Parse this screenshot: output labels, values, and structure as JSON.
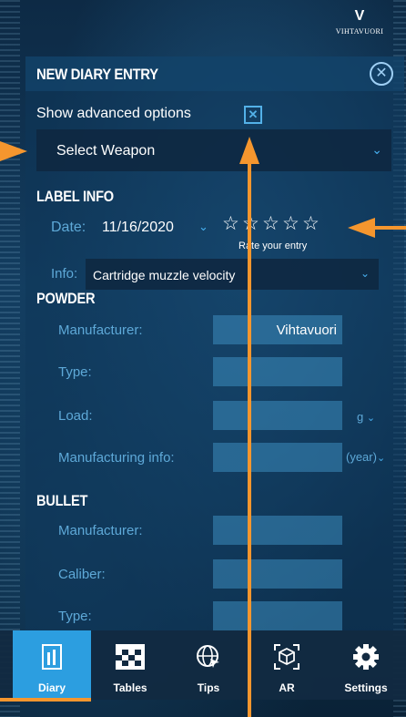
{
  "brand": {
    "mark": "V",
    "name": "VIHTAVUORI"
  },
  "header": {
    "title": "NEW DIARY ENTRY"
  },
  "advanced": {
    "label": "Show advanced options",
    "checkbox_mark": "✕"
  },
  "weapon": {
    "label": "Select Weapon"
  },
  "label_info": {
    "title": "LABEL INFO",
    "date_label": "Date:",
    "date_value": "11/16/2020",
    "rating": {
      "value": 0,
      "max": 5,
      "star": "☆"
    },
    "rate_text": "Rate your entry",
    "info_label": "Info:",
    "info_value": "Cartridge muzzle velocity"
  },
  "powder": {
    "title": "POWDER",
    "manufacturer_label": "Manufacturer:",
    "manufacturer_value": "Vihtavuori",
    "type_label": "Type:",
    "load_label": "Load:",
    "load_unit": "g",
    "mfg_info_label": "Manufacturing info:",
    "mfg_info_unit": "(year)"
  },
  "bullet": {
    "title": "BULLET",
    "manufacturer_label": "Manufacturer:",
    "caliber_label": "Caliber:",
    "type_label": "Type:"
  },
  "tabs": [
    {
      "label": "Diary",
      "icon": "diary-icon",
      "active": true
    },
    {
      "label": "Tables",
      "icon": "tables-icon",
      "active": false
    },
    {
      "label": "Tips",
      "icon": "tips-icon",
      "active": false
    },
    {
      "label": "AR",
      "icon": "ar-icon",
      "active": false
    },
    {
      "label": "Settings",
      "icon": "settings-icon",
      "active": false
    }
  ],
  "colors": {
    "accent": "#2c9ee0",
    "annotation_arrow": "#f5962e",
    "label_blue": "#5ea9d8"
  }
}
